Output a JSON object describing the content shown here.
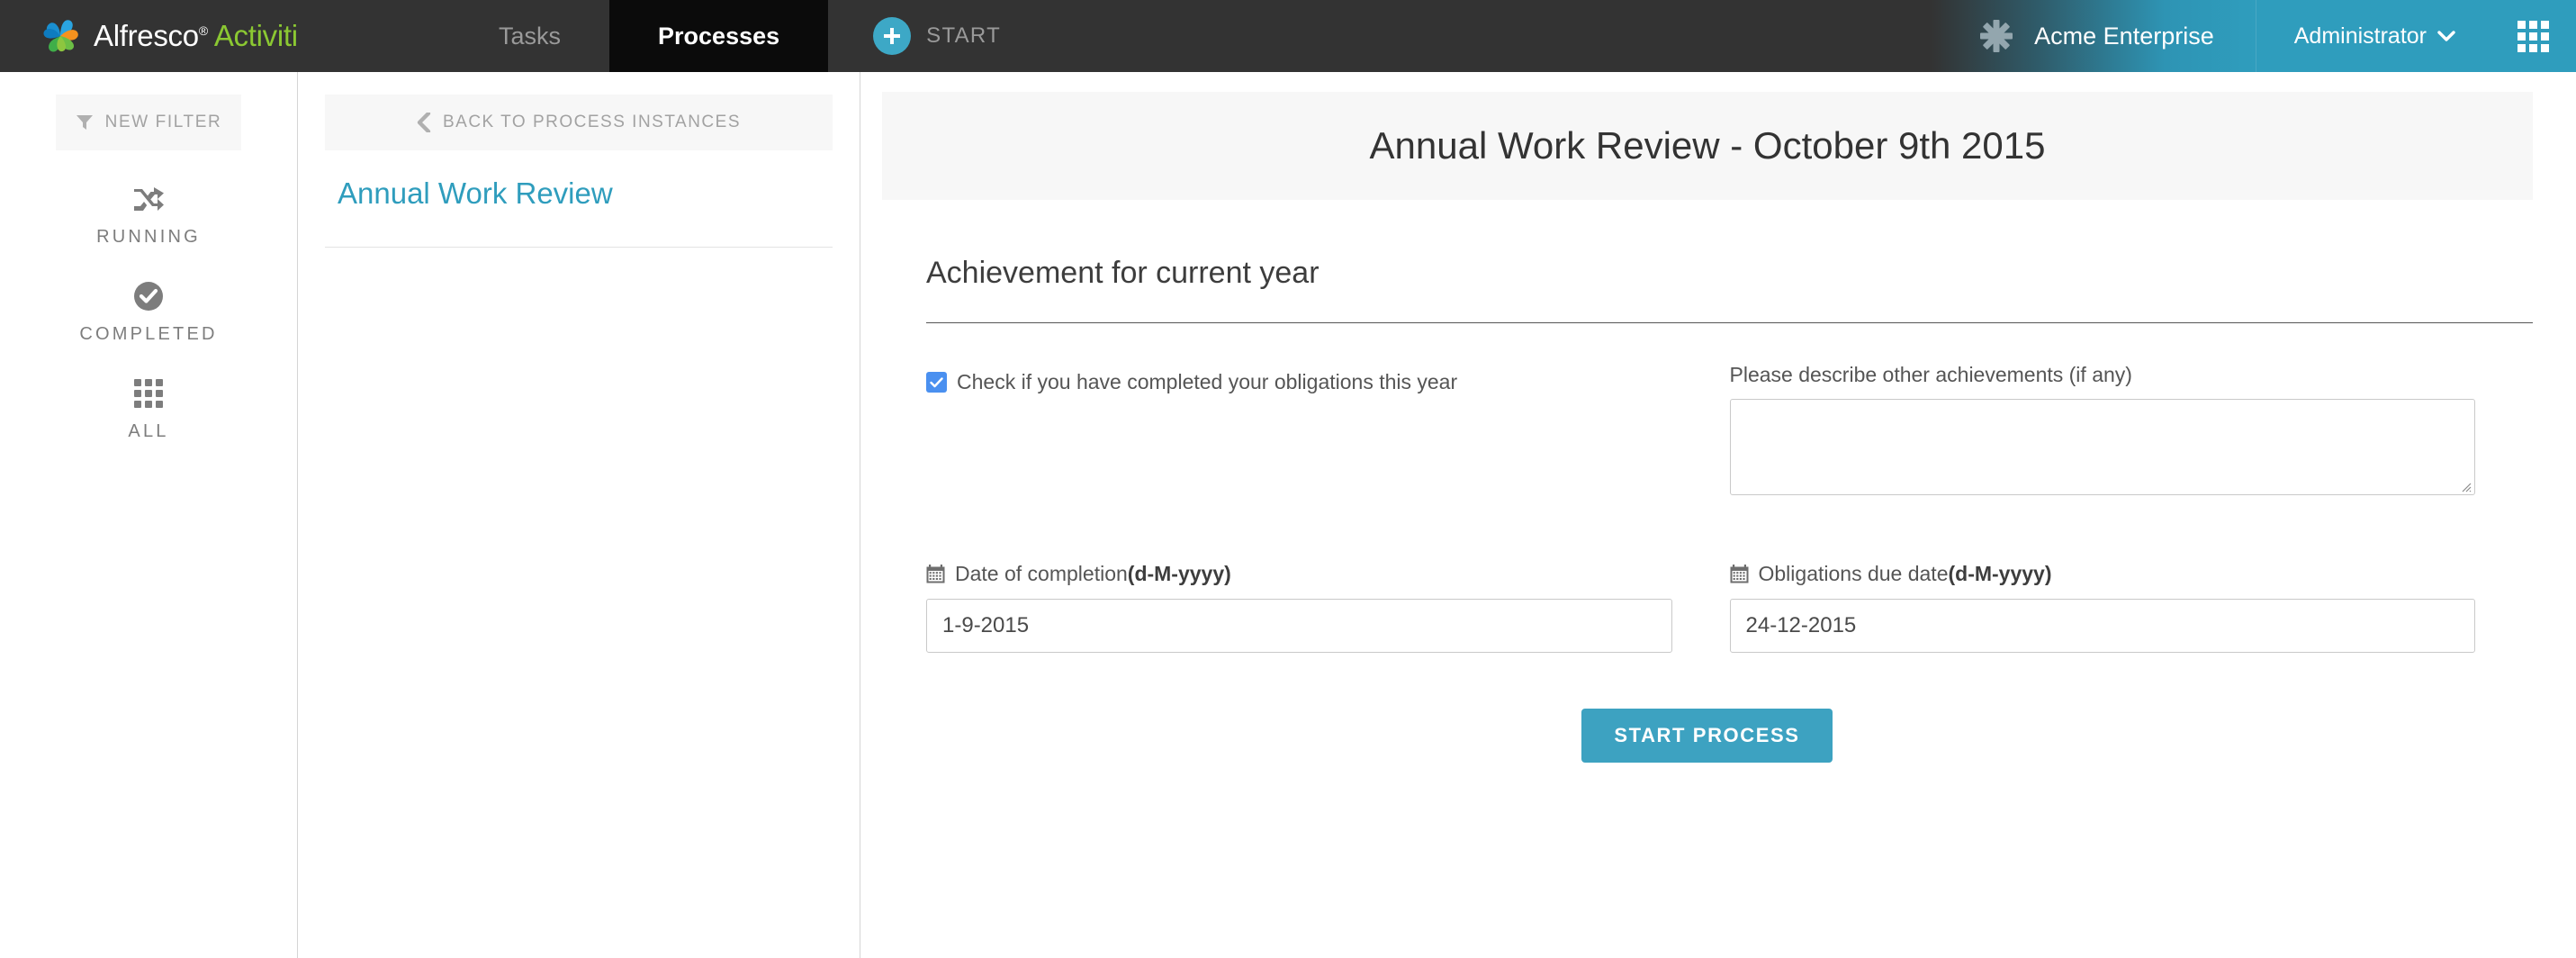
{
  "brand": {
    "alfresco": "Alfresco",
    "registered": "®",
    "activiti": "Activiti",
    "logo_icon": "alfresco-pinwheel-logo"
  },
  "topnav": {
    "tabs": [
      {
        "label": "Tasks",
        "active": false
      },
      {
        "label": "Processes",
        "active": true
      }
    ],
    "start": {
      "label": "START",
      "icon": "plus-circle-icon"
    },
    "tenant": {
      "name": "Acme Enterprise",
      "icon": "asterisk-icon"
    },
    "user": {
      "label": "Administrator",
      "caret_icon": "chevron-down-icon"
    },
    "apps_icon": "apps-grid-icon"
  },
  "sidebar": {
    "new_filter": {
      "label": "NEW FILTER",
      "icon": "filter-funnel-icon"
    },
    "items": [
      {
        "label": "RUNNING",
        "icon": "shuffle-arrows-icon"
      },
      {
        "label": "COMPLETED",
        "icon": "check-circle-icon"
      },
      {
        "label": "ALL",
        "icon": "grid-squares-icon"
      }
    ]
  },
  "list_panel": {
    "back_label": "BACK TO PROCESS INSTANCES",
    "back_icon": "chevron-left-icon",
    "process_name": "Annual Work Review"
  },
  "form": {
    "title": "Annual Work Review - October 9th 2015",
    "section_title": "Achievement for current year",
    "checkbox": {
      "label": "Check if you have completed your obligations this year",
      "checked": true,
      "check_icon": "checkmark-icon"
    },
    "textarea": {
      "label": "Please describe other achievements (if any)",
      "value": "",
      "placeholder": ""
    },
    "date_completion": {
      "label_plain": "Date of completion ",
      "label_format": "(d-M-yyyy)",
      "icon": "calendar-icon",
      "value": "1-9-2015",
      "placeholder": "d-M-yyyy"
    },
    "date_obligations": {
      "label_plain": "Obligations due date ",
      "label_format": "(d-M-yyyy)",
      "icon": "calendar-icon",
      "value": "24-12-2015",
      "placeholder": "d-M-yyyy"
    },
    "submit_label": "START PROCESS"
  },
  "colors": {
    "topbar_bg": "#333333",
    "active_tab_bg": "#0b0b0b",
    "teal": "#2f9dbd",
    "button_teal": "#3da2c1",
    "link_teal": "#2f9dbd",
    "activiti_green": "#8bc832",
    "checkbox_blue": "#4a90f0",
    "panel_gray": "#f7f7f7"
  }
}
